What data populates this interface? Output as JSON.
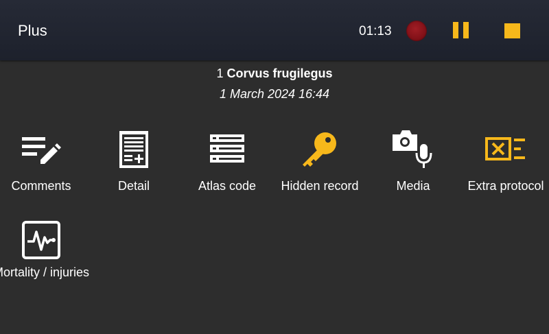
{
  "appbar": {
    "title": "Plus",
    "timer": "01:13",
    "record_icon": "record-icon",
    "pause_icon": "pause-icon",
    "stop_icon": "stop-icon",
    "accent_color": "#f7b81b",
    "record_color": "#8a1219"
  },
  "observation": {
    "count": "1",
    "species": "Corvus frugilegus",
    "datetime": "1 March 2024 16:44"
  },
  "actions": [
    {
      "label": "Comments",
      "icon": "comments-icon"
    },
    {
      "label": "Detail",
      "icon": "detail-icon"
    },
    {
      "label": "Atlas code",
      "icon": "atlas-code-icon"
    },
    {
      "label": "Hidden record",
      "icon": "key-icon"
    },
    {
      "label": "Media",
      "icon": "camera-microphone-icon"
    },
    {
      "label": "Extra protocol",
      "icon": "extra-protocol-icon"
    },
    {
      "label": "Mortality / injuries",
      "icon": "mortality-icon"
    }
  ],
  "colors": {
    "background": "#2d2d2d",
    "appbar": "#1f232e",
    "icon_white": "#ffffff",
    "icon_yellow": "#f7b81b"
  }
}
